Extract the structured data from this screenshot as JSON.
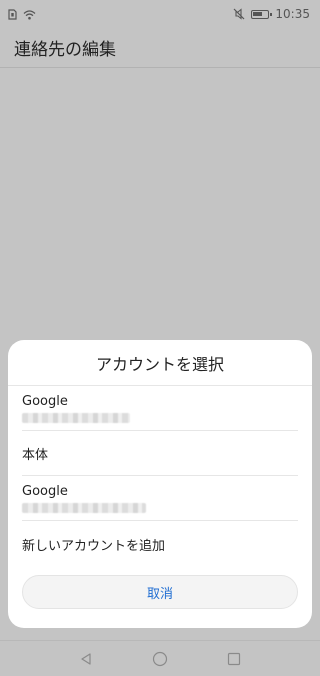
{
  "status_bar": {
    "time": "10:35",
    "icons": [
      "sim-icon",
      "wifi-icon",
      "mute-icon",
      "battery-icon"
    ]
  },
  "app_bar": {
    "title": "連絡先の編集"
  },
  "dialog": {
    "title": "アカウントを選択",
    "items": [
      {
        "label": "Google"
      },
      {
        "label": "本体"
      },
      {
        "label": "Google"
      },
      {
        "label": "新しいアカウントを追加"
      }
    ],
    "cancel_label": "取消"
  },
  "colors": {
    "accent": "#1f6dd2",
    "scrim": "#c4c4c4",
    "dialog_bg": "#ffffff"
  },
  "nav_bar": {
    "icons": [
      "back-icon",
      "home-icon",
      "recents-icon"
    ]
  }
}
